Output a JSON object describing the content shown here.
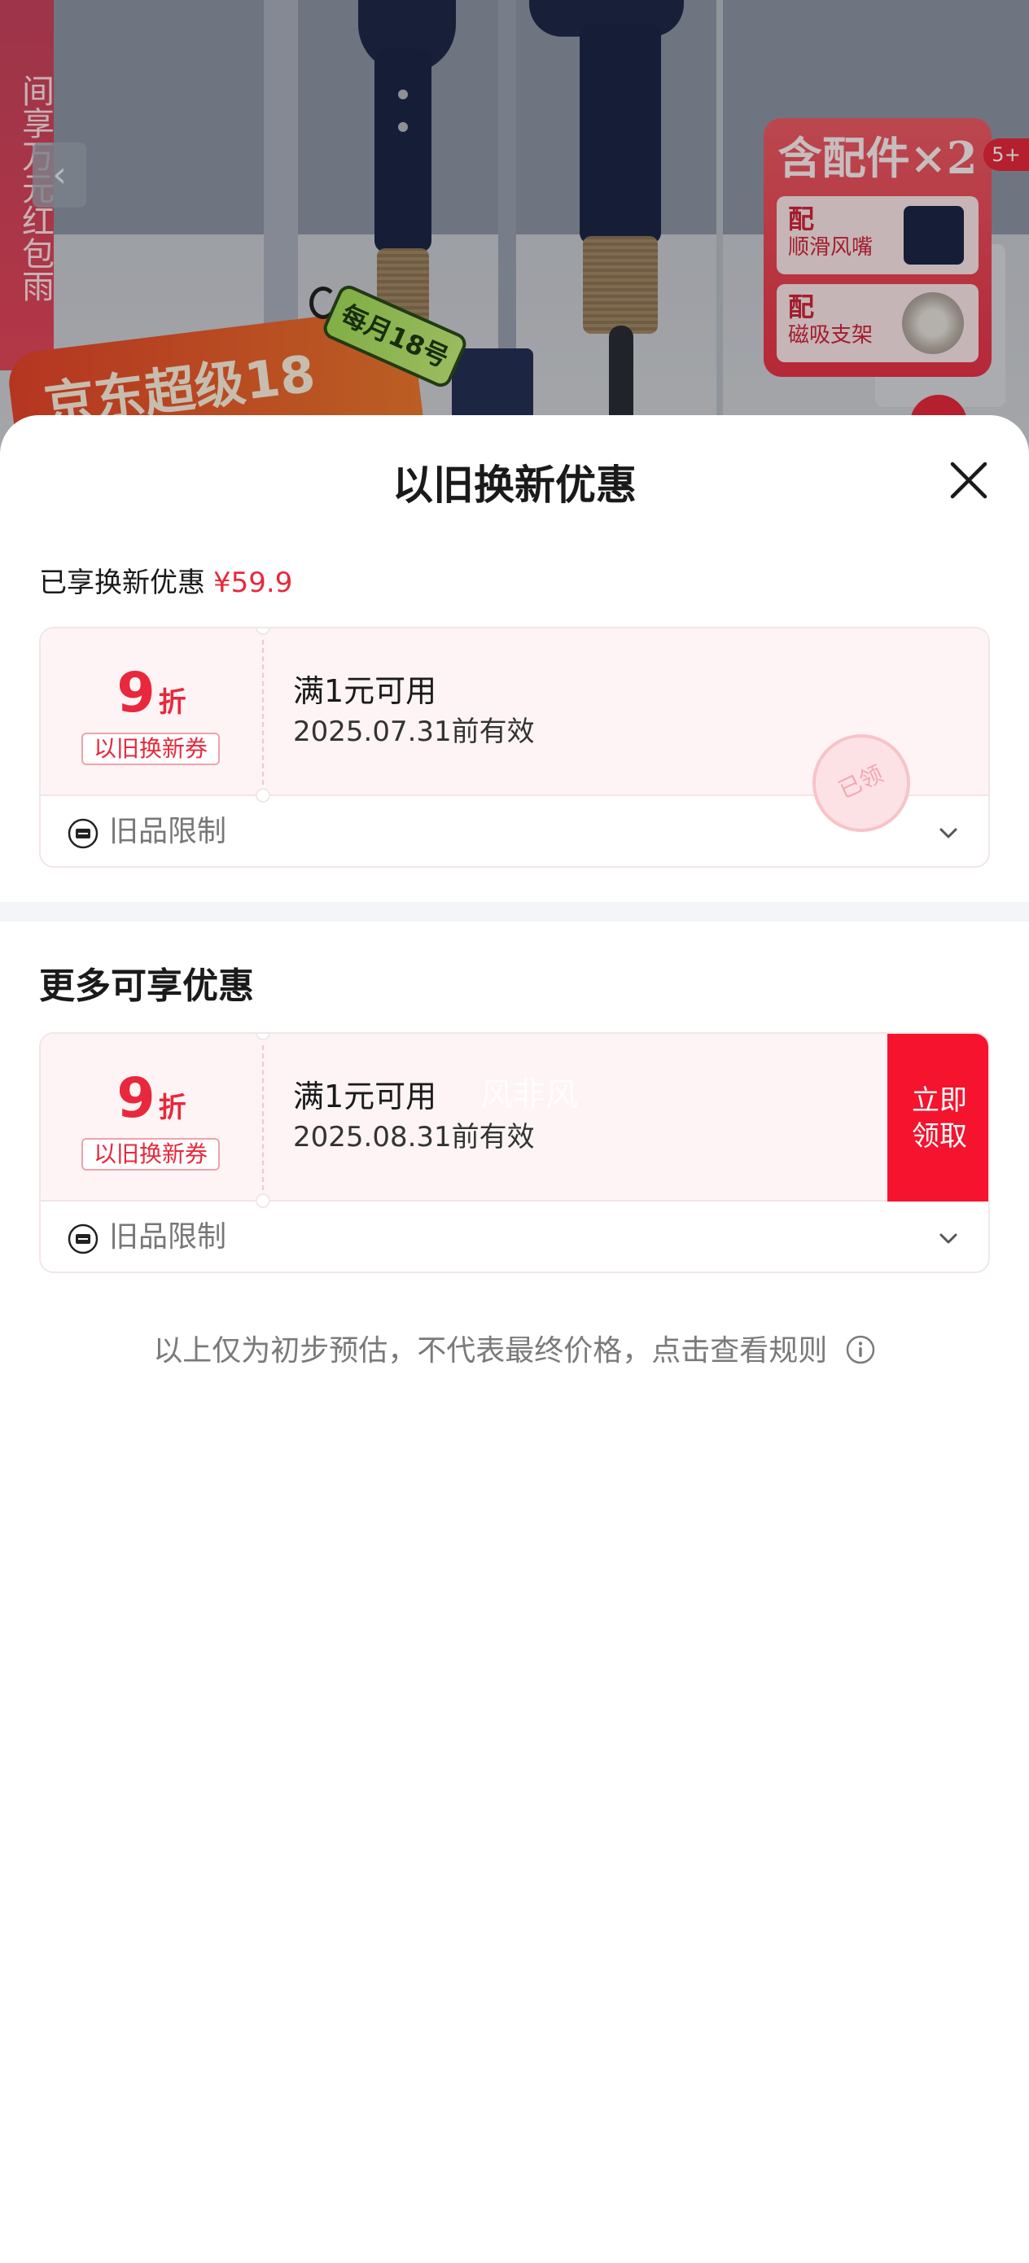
{
  "background": {
    "vertical_banner": "间享万元红包雨",
    "promo_text": "京东超级18",
    "promo_tag": "每月18号",
    "accessory_box": {
      "title": "含配件×2",
      "items": [
        {
          "tag": "配",
          "name": "顺滑风嘴"
        },
        {
          "tag": "配",
          "name": "磁吸支架"
        }
      ]
    },
    "badge": "5+"
  },
  "sheet": {
    "title": "以旧换新优惠",
    "close_icon": "close-icon",
    "enjoyed_label": "已享换新优惠",
    "enjoyed_amount": "¥59.9",
    "claimed_coupon": {
      "discount_value": "9",
      "discount_unit": "折",
      "type_label": "以旧换新券",
      "condition": "满1元可用",
      "valid_until": "2025.07.31前有效",
      "stamp_text": "已领",
      "restriction_label": "旧品限制"
    },
    "more_section_title": "更多可享优惠",
    "available_coupon": {
      "discount_value": "9",
      "discount_unit": "折",
      "type_label": "以旧换新券",
      "condition": "满1元可用",
      "valid_until": "2025.08.31前有效",
      "ghost_text": "风非风",
      "claim_label_line1": "立即",
      "claim_label_line2": "领取",
      "restriction_label": "旧品限制"
    },
    "footnote": "以上仅为初步预估，不代表最终价格，点击查看规则"
  },
  "colors": {
    "accent_red": "#e8283c",
    "claim_button": "#f5132d",
    "coupon_bg": "#fff4f5"
  }
}
